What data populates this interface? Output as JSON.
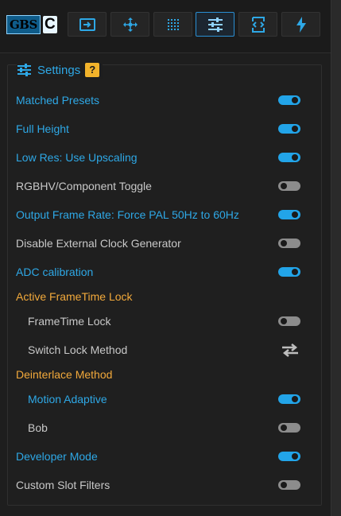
{
  "logo": {
    "gbs": "GBS",
    "c": "C"
  },
  "tabs": [
    {
      "name": "input-tab",
      "icon": "input-icon",
      "active": false
    },
    {
      "name": "move-tab",
      "icon": "move-arrows-icon",
      "active": false
    },
    {
      "name": "scanlines-tab",
      "icon": "grid-dots-icon",
      "active": false
    },
    {
      "name": "settings-tab",
      "icon": "sliders-icon",
      "active": true
    },
    {
      "name": "slots-tab",
      "icon": "code-icon",
      "active": false
    },
    {
      "name": "power-tab",
      "icon": "lightning-icon",
      "active": false
    }
  ],
  "settings": {
    "title": "Settings",
    "help": "?",
    "items": [
      {
        "label": "Matched Presets",
        "state": "on"
      },
      {
        "label": "Full Height",
        "state": "on"
      },
      {
        "label": "Low Res: Use Upscaling",
        "state": "on"
      },
      {
        "label": "RGBHV/Component Toggle",
        "state": "off"
      },
      {
        "label": "Output Frame Rate: Force PAL 50Hz to 60Hz",
        "state": "on"
      },
      {
        "label": "Disable External Clock Generator",
        "state": "off"
      },
      {
        "label": "ADC calibration",
        "state": "on"
      },
      {
        "label": "Active FrameTime Lock",
        "type": "section"
      },
      {
        "label": "FrameTime Lock",
        "state": "off"
      },
      {
        "label": "Switch Lock Method",
        "type": "action",
        "icon": "swap-arrows-icon"
      },
      {
        "label": "Deinterlace Method",
        "type": "section"
      },
      {
        "label": "Motion Adaptive",
        "state": "on"
      },
      {
        "label": "Bob",
        "state": "off"
      },
      {
        "label": "Developer Mode",
        "state": "on"
      },
      {
        "label": "Custom Slot Filters",
        "state": "off"
      }
    ]
  },
  "colors": {
    "accent": "#22a4e8",
    "section": "#f2a93b",
    "text": "#c8c8c8",
    "background": "#1e1e1e"
  }
}
